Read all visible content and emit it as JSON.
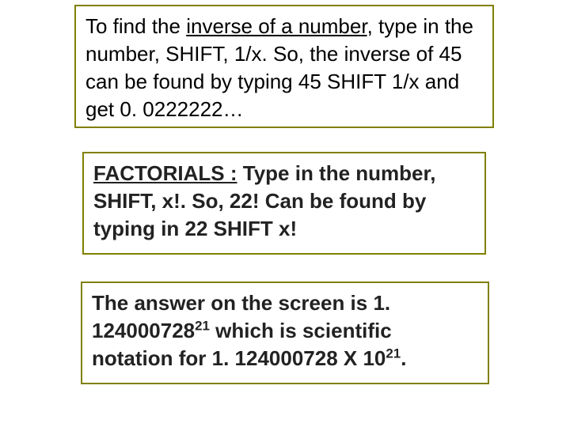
{
  "para1": {
    "t1": "To find the ",
    "t2_underlined": "inverse of a number",
    "t3": ", type in the number, SHIFT, 1/x.  So, the inverse of  45 can be found by typing 45  SHIFT  1/x  and get  0. 0222222…"
  },
  "para2": {
    "t1_underlined": "FACTORIALS :",
    "t2": "  Type in the number, SHIFT, x!.  So, 22! Can be found by typing in  22 SHIFT  x!"
  },
  "para3": {
    "t1": "The answer on the screen is 1. 124000728",
    "exp1": "21",
    "t2": "  which is scientific notation for  1. 124000728 X 10",
    "exp2": "21",
    "t3": "."
  }
}
